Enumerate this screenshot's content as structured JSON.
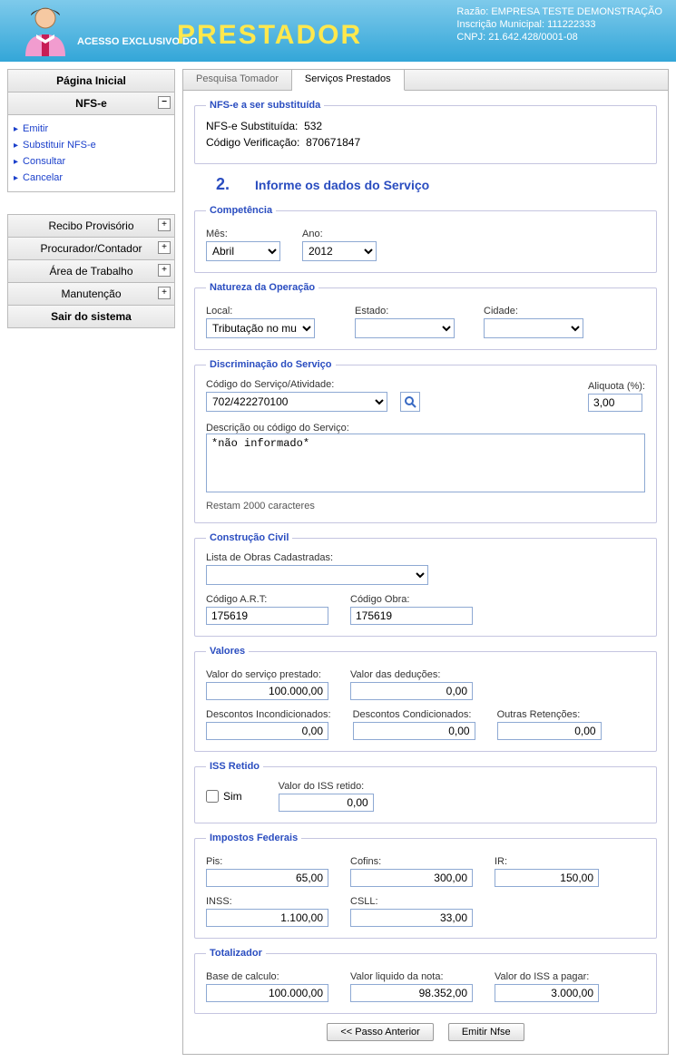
{
  "header": {
    "access_text": "ACESSO EXCLUSIVO DO",
    "prestador": "PRESTADOR",
    "company": {
      "razao_label": "Razão:",
      "razao": "EMPRESA TESTE DEMONSTRAÇÃO",
      "inscricao_label": "Inscrição Municipal:",
      "inscricao": "111222333",
      "cnpj_label": "CNPJ:",
      "cnpj": "21.642.428/0001-08"
    }
  },
  "sidebar": {
    "home": "Página Inicial",
    "nfse": "NFS-e",
    "sub": {
      "emitir": "Emitir",
      "substituir": "Substituir NFS-e",
      "consultar": "Consultar",
      "cancelar": "Cancelar"
    },
    "recibo": "Recibo Provisório",
    "procurador": "Procurador/Contador",
    "area": "Área de Trabalho",
    "manutencao": "Manutenção",
    "sair": "Sair do sistema"
  },
  "tabs": {
    "pesquisa": "Pesquisa Tomador",
    "servicos": "Serviços Prestados"
  },
  "substituida": {
    "legend": "NFS-e a ser substituída",
    "nfse_label": "NFS-e Substituída:",
    "nfse_val": "532",
    "codigo_label": "Código Verificação:",
    "codigo_val": "870671847"
  },
  "step": {
    "num": "2.",
    "title": "Informe os dados do Serviço"
  },
  "competencia": {
    "legend": "Competência",
    "mes_label": "Mês:",
    "mes_val": "Abril",
    "ano_label": "Ano:",
    "ano_val": "2012"
  },
  "natureza": {
    "legend": "Natureza da Operação",
    "local_label": "Local:",
    "local_val": "Tributação no mu",
    "estado_label": "Estado:",
    "estado_val": "",
    "cidade_label": "Cidade:",
    "cidade_val": ""
  },
  "discriminacao": {
    "legend": "Discriminação do Serviço",
    "codigo_label": "Código do Serviço/Atividade:",
    "codigo_val": "702/422270100",
    "aliquota_label": "Aliquota (%):",
    "aliquota_val": "3,00",
    "descricao_label": "Descrição ou código do Serviço:",
    "descricao_val": "*não informado*",
    "restam": "Restam 2000 caracteres"
  },
  "construcao": {
    "legend": "Construção Civil",
    "lista_label": "Lista de Obras Cadastradas:",
    "lista_val": "",
    "art_label": "Código A.R.T:",
    "art_val": "175619",
    "obra_label": "Código Obra:",
    "obra_val": "175619"
  },
  "valores": {
    "legend": "Valores",
    "servico_label": "Valor do serviço prestado:",
    "servico_val": "100.000,00",
    "deducoes_label": "Valor das deduções:",
    "deducoes_val": "0,00",
    "desc_inc_label": "Descontos Incondicionados:",
    "desc_inc_val": "0,00",
    "desc_cond_label": "Descontos Condicionados:",
    "desc_cond_val": "0,00",
    "outras_label": "Outras Retenções:",
    "outras_val": "0,00"
  },
  "iss": {
    "legend": "ISS Retido",
    "sim_label": "Sim",
    "valor_label": "Valor do ISS retido:",
    "valor_val": "0,00"
  },
  "impostos": {
    "legend": "Impostos Federais",
    "pis_label": "Pis:",
    "pis_val": "65,00",
    "cofins_label": "Cofins:",
    "cofins_val": "300,00",
    "ir_label": "IR:",
    "ir_val": "150,00",
    "inss_label": "INSS:",
    "inss_val": "1.100,00",
    "csll_label": "CSLL:",
    "csll_val": "33,00"
  },
  "totalizador": {
    "legend": "Totalizador",
    "base_label": "Base de calculo:",
    "base_val": "100.000,00",
    "liquido_label": "Valor liquido da nota:",
    "liquido_val": "98.352,00",
    "iss_pagar_label": "Valor do ISS a pagar:",
    "iss_pagar_val": "3.000,00"
  },
  "footer": {
    "anterior": "<< Passo Anterior",
    "emitir": "Emitir Nfse"
  }
}
